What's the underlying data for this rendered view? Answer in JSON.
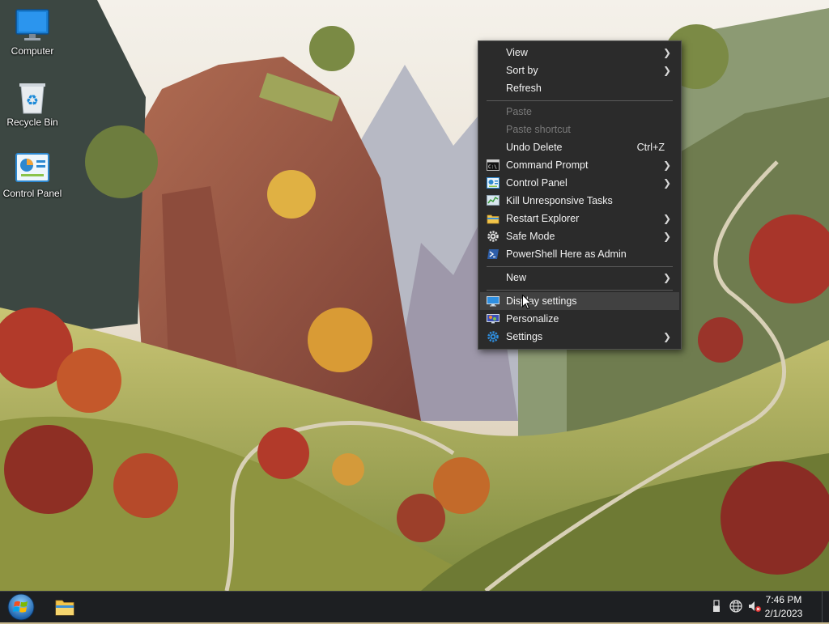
{
  "desktop": {
    "icons": [
      {
        "label": "Computer",
        "icon": "computer-icon"
      },
      {
        "label": "Recycle Bin",
        "icon": "recycle-bin-icon"
      },
      {
        "label": "Control Panel",
        "icon": "control-panel-icon"
      }
    ]
  },
  "context_menu": {
    "items": [
      {
        "label": "View",
        "submenu": true
      },
      {
        "label": "Sort by",
        "submenu": true
      },
      {
        "label": "Refresh"
      },
      {
        "label": "Paste",
        "disabled": true
      },
      {
        "label": "Paste shortcut",
        "disabled": true
      },
      {
        "label": "Undo Delete",
        "shortcut": "Ctrl+Z"
      },
      {
        "label": "Command Prompt",
        "submenu": true,
        "icon": "command-prompt-icon"
      },
      {
        "label": "Control Panel",
        "submenu": true,
        "icon": "control-panel-icon"
      },
      {
        "label": "Kill Unresponsive Tasks",
        "icon": "task-manager-icon"
      },
      {
        "label": "Restart Explorer",
        "submenu": true,
        "icon": "folder-icon"
      },
      {
        "label": "Safe Mode",
        "submenu": true,
        "icon": "gear-icon"
      },
      {
        "label": "PowerShell Here as Admin",
        "icon": "powershell-icon"
      },
      {
        "label": "New",
        "submenu": true
      },
      {
        "label": "Display settings",
        "highlighted": true,
        "icon": "display-icon"
      },
      {
        "label": "Personalize",
        "icon": "personalize-icon"
      },
      {
        "label": "Settings",
        "submenu": true,
        "icon": "settings-gear-icon"
      }
    ],
    "arrow_glyph": "❯"
  },
  "taskbar": {
    "clock": {
      "time": "7:46 PM",
      "date": "2/1/2023"
    },
    "pinned": [
      "file-explorer-icon"
    ],
    "tray": [
      "usb-icon",
      "network-globe-icon",
      "volume-muted-icon"
    ]
  },
  "colors": {
    "menu_bg": "#2b2b2b",
    "menu_hover": "#414141",
    "taskbar_bg": "#1d1f22"
  }
}
